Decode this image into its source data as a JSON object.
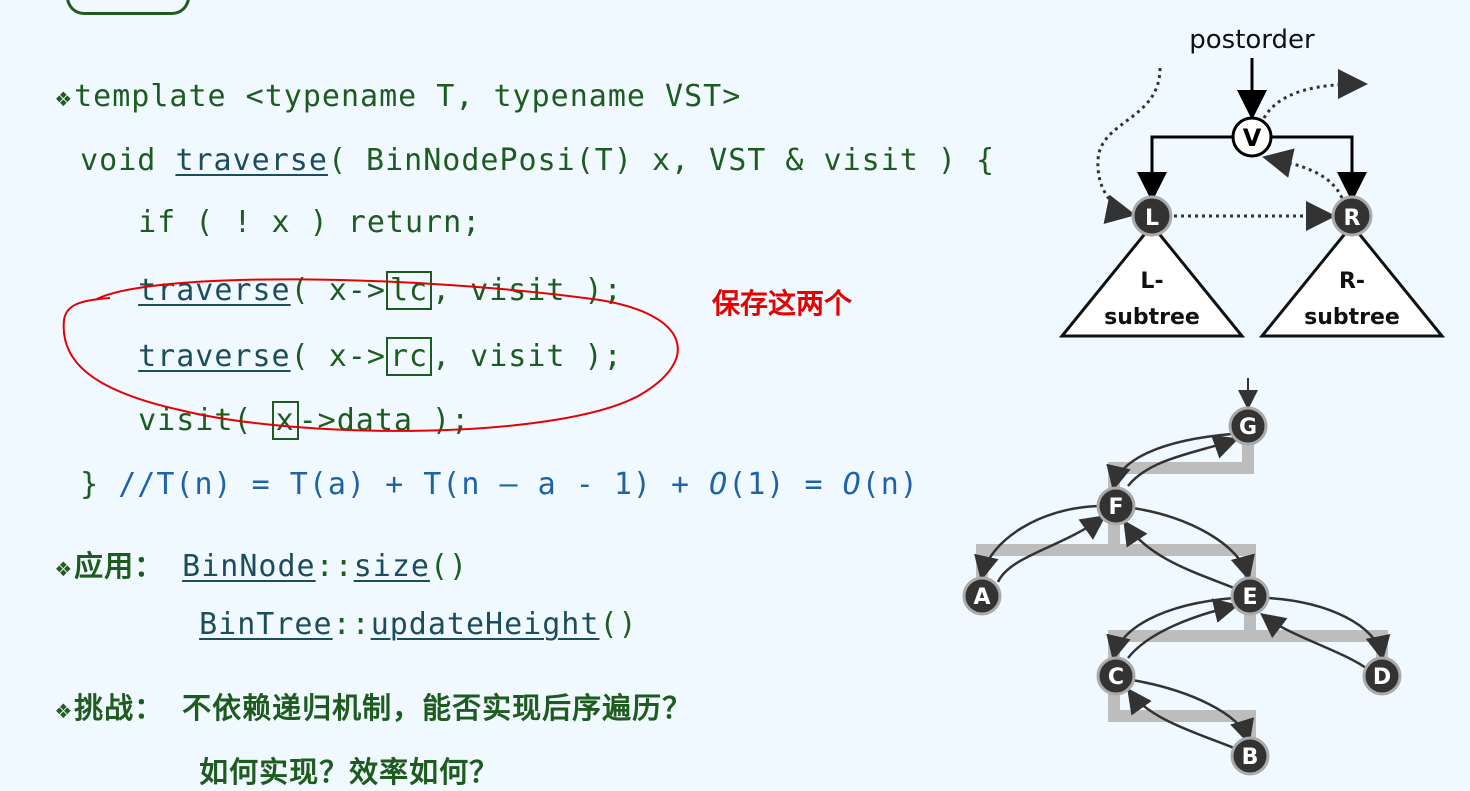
{
  "code": {
    "line1": "template <typename T, typename VST>",
    "line2_pre": "void ",
    "line2_fn": "traverse",
    "line2_post": "( BinNodePosi(T) x, VST & visit ) {",
    "line3": "if ( ! x ) return;",
    "line4_fn": "traverse",
    "line4_a": "( x->",
    "line4_box": "lc",
    "line4_b": ", visit );",
    "line5_fn": "traverse",
    "line5_a": "( x->",
    "line5_box": "rc",
    "line5_b": ", visit );",
    "line6_a": "visit( ",
    "line6_box": "x",
    "line6_b": "->data );",
    "line7_brace": "} ",
    "line7_comment_a": "//T(n) = T(a) + T(n – a - 1) + ",
    "line7_o1": "O",
    "line7_comment_b": "(1) = ",
    "line7_o2": "O",
    "line7_comment_c": "(n)"
  },
  "apply": {
    "label": "应用：",
    "item1_cls": "BinNode",
    "item1_sep": "::",
    "item1_fn": "size",
    "item1_paren": "()",
    "item2_cls": "BinTree",
    "item2_sep": "::",
    "item2_fn": "updateHeight",
    "item2_paren": "()"
  },
  "challenge": {
    "label": "挑战：",
    "line1": "不依赖递归机制，能否实现后序遍历？",
    "line2": "如何实现？效率如何？"
  },
  "annotation": "保存这两个",
  "diagram_top": {
    "title": "postorder",
    "root": "V",
    "left": "L",
    "right": "R",
    "left_sub_1": "L-",
    "left_sub_2": "subtree",
    "right_sub_1": "R-",
    "right_sub_2": "subtree"
  },
  "diagram_bottom": {
    "nodes": [
      "G",
      "F",
      "A",
      "E",
      "C",
      "D",
      "B"
    ]
  },
  "colors": {
    "code_green": "#1e5b1e",
    "comment_blue": "#1e63a8",
    "annotation_red": "#e60000",
    "node_dark": "#333333",
    "path_gray": "#bdbdbd"
  }
}
